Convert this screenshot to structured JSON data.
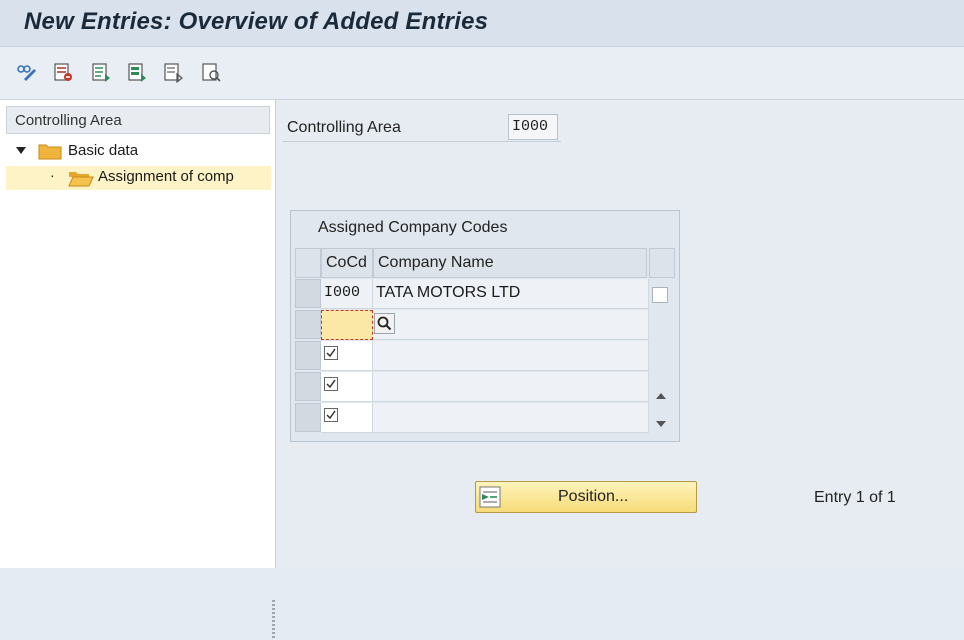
{
  "window": {
    "title": "New Entries: Overview of Added Entries"
  },
  "toolbar": {
    "icons": [
      "change-display-icon",
      "delete-icon",
      "copy-icon",
      "select-all-icon",
      "deselect-icon",
      "print-preview-icon"
    ]
  },
  "nav": {
    "header": "Controlling Area",
    "items": [
      {
        "label": "Basic data",
        "expanded": true
      },
      {
        "label": "Assignment of comp",
        "selected": true
      }
    ]
  },
  "form": {
    "controlling_area_label": "Controlling Area",
    "controlling_area_value": "I000"
  },
  "table": {
    "title": "Assigned Company Codes",
    "columns": [
      "CoCd",
      "Company Name"
    ],
    "rows": [
      {
        "cocd": "I000",
        "name": "TATA MOTORS LTD"
      },
      {
        "cocd": "",
        "name": ""
      }
    ],
    "checkbox_rows": 3
  },
  "footer": {
    "position_button": "Position...",
    "entry_status": "Entry 1 of 1"
  },
  "colors": {
    "title_bar": "#d9e2ec",
    "selected_tree_item": "#fdf3c6",
    "button_fill": "#f5db78",
    "folder": "#f0b43c"
  }
}
